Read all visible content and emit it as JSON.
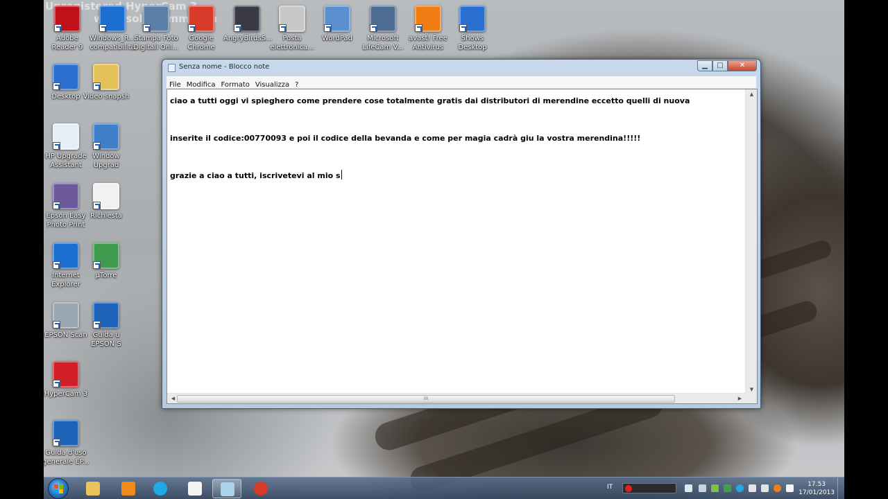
{
  "watermark": {
    "line1": "Unregistered HyperCam 3",
    "line2": "www.solveigmm.com"
  },
  "desktop": {
    "top_icons": [
      {
        "label": "Adobe Reader 9",
        "icon": "adobe-reader-icon",
        "color": "#c0111a"
      },
      {
        "label": "Windows_R... compatibilità",
        "icon": "internet-explorer-icon",
        "color": "#1c6fd0"
      },
      {
        "label": "Stampa Foto Digitali Onl...",
        "icon": "photo-print-icon",
        "color": "#5a7fa8"
      },
      {
        "label": "Google Chrome",
        "icon": "chrome-icon",
        "color": "#d93b2b"
      },
      {
        "label": "AngryBirdsS...",
        "icon": "angry-birds-icon",
        "color": "#3a3a46"
      },
      {
        "label": "Posta elettronica...",
        "icon": "mail-icon",
        "color": "#c8c8c8"
      },
      {
        "label": "WordPad",
        "icon": "wordpad-icon",
        "color": "#5b8fd0"
      },
      {
        "label": "Microsoft LifeCam V...",
        "icon": "webcam-icon",
        "color": "#4d6e92"
      },
      {
        "label": "avast! Free Antivirus",
        "icon": "avast-icon",
        "color": "#f07d14"
      },
      {
        "label": "Shows Desktop",
        "icon": "show-desktop-icon",
        "color": "#2a6fcf"
      }
    ],
    "left_icons": [
      {
        "label": "Desktop",
        "icon": "desktop-icon",
        "color": "#2a6fcf"
      },
      {
        "label": "HP Upgrade Assistant",
        "icon": "hp-upgrade-icon",
        "color": "#e6eef7"
      },
      {
        "label": "Epson Easy Photo Print",
        "icon": "epson-photo-icon",
        "color": "#6d5a9c"
      },
      {
        "label": "Internet Explorer",
        "icon": "internet-explorer-icon",
        "color": "#1c6fd0"
      },
      {
        "label": "EPSON Scan",
        "icon": "scanner-icon",
        "color": "#9aa6b2"
      },
      {
        "label": "HyperCam 3",
        "icon": "hypercam-icon",
        "color": "#d21f2a"
      },
      {
        "label": "Guida d'uso generale EP...",
        "icon": "epson-guide-icon",
        "color": "#1d63b8"
      }
    ],
    "second_column_icons": [
      {
        "label": "Video snapsh",
        "icon": "folder-icon",
        "color": "#e3c25a"
      },
      {
        "label": "Window Upgrad",
        "icon": "windows-upgrade-icon",
        "color": "#3f7fca"
      },
      {
        "label": "Richiesta",
        "icon": "document-icon",
        "color": "#f1f1f1"
      },
      {
        "label": "µTorre",
        "icon": "utorrent-icon",
        "color": "#3f9a4e"
      },
      {
        "label": "Guida u EPSON S",
        "icon": "epson-guide-icon",
        "color": "#1d63b8"
      }
    ]
  },
  "notepad": {
    "title": "Senza nome - Blocco note",
    "buttons": {
      "minimize": "▁",
      "maximize": "□",
      "close": "✕"
    },
    "menu": [
      "File",
      "Modifica",
      "Formato",
      "Visualizza",
      "?"
    ],
    "lines": [
      "ciao a tutti oggi vi spieghero come prendere cose totalmente gratis dai distributori di merendine eccetto quelli di nuova",
      "",
      "inserite il codice:00770093 e poi il codice della bevanda e come per magia cadrà giu la vostra merendina!!!!!",
      "",
      "grazie a ciao a tutti, iscrivetevi al mio s"
    ],
    "hscroll_grip": "III"
  },
  "taskbar": {
    "items": [
      {
        "name": "explorer",
        "icon": "folder-icon",
        "color": "#e8c35e"
      },
      {
        "name": "media-player",
        "icon": "media-player-icon",
        "color": "#f08a1c"
      },
      {
        "name": "skype",
        "icon": "skype-icon",
        "color": "#1fa9e6"
      },
      {
        "name": "notepad-blank",
        "icon": "blank-document-icon",
        "color": "#f4f4f4"
      },
      {
        "name": "notepad",
        "icon": "notepad-icon",
        "color": "#a9d4ea"
      },
      {
        "name": "chrome",
        "icon": "chrome-icon",
        "color": "#d93b2b"
      }
    ],
    "language": "IT",
    "clock_time": "17.53",
    "clock_date": "17/01/2013"
  }
}
